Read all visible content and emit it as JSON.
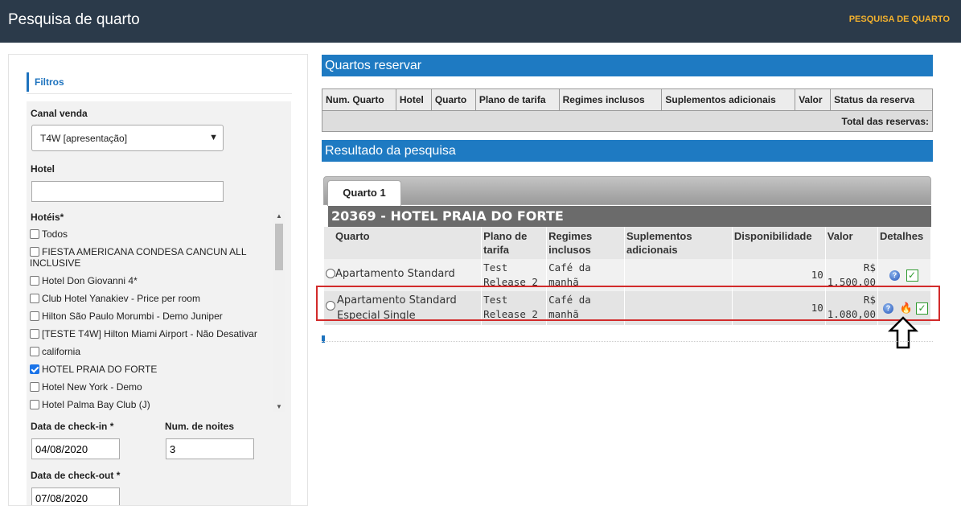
{
  "header": {
    "title": "Pesquisa de quarto",
    "breadcrumb": "PESQUISA DE QUARTO"
  },
  "filters": {
    "title": "Filtros",
    "canal_label": "Canal venda",
    "canal_value": "T4W [apresentação]",
    "hotel_label": "Hotel",
    "hotel_value": "",
    "hoteis_label": "Hotéis*",
    "hoteis": [
      {
        "label": "Todos",
        "checked": false
      },
      {
        "label": "FIESTA AMERICANA CONDESA CANCUN ALL INCLUSIVE",
        "checked": false
      },
      {
        "label": "Hotel Don Giovanni 4*",
        "checked": false
      },
      {
        "label": "Club Hotel Yanakiev - Price per room",
        "checked": false
      },
      {
        "label": "Hilton São Paulo Morumbi - Demo Juniper",
        "checked": false
      },
      {
        "label": "[TESTE T4W] Hilton Miami Airport - Não Desativar",
        "checked": false
      },
      {
        "label": "california",
        "checked": false
      },
      {
        "label": "HOTEL PRAIA DO FORTE",
        "checked": true
      },
      {
        "label": "Hotel New York - Demo",
        "checked": false
      },
      {
        "label": "Hotel Palma Bay Club (J)",
        "checked": false
      }
    ],
    "checkin_label": "Data de check-in *",
    "checkin_value": "04/08/2020",
    "noites_label": "Num. de noites",
    "noites_value": "3",
    "checkout_label": "Data de check-out *",
    "checkout_value": "07/08/2020"
  },
  "reservar": {
    "title": "Quartos reservar",
    "columns": [
      "Num. Quarto",
      "Hotel",
      "Quarto",
      "Plano de tarifa",
      "Regimes inclusos",
      "Suplementos adicionais",
      "Valor",
      "Status da reserva"
    ],
    "total_label": "Total das reservas:"
  },
  "resultado": {
    "title": "Resultado da pesquisa",
    "tab": "Quarto 1",
    "hotel_header": "20369 - HOTEL PRAIA DO FORTE",
    "columns": {
      "quarto": "Quarto",
      "plano": "Plano de tarifa",
      "regimes": "Regimes inclusos",
      "suplementos": "Suplementos adicionais",
      "disponibilidade": "Disponibilidade",
      "valor": "Valor",
      "detalhes": "Detalhes"
    },
    "rows": [
      {
        "quarto": "Apartamento Standard",
        "plano": "Test Release 2",
        "regime": "Café da manhã",
        "suplementos": "",
        "disponibilidade": "10",
        "valor": "R$ 1.500,00"
      },
      {
        "quarto": "Apartamento Standard Especial Single",
        "plano": "Test Release 2",
        "regime": "Café da manhã",
        "suplementos": "",
        "disponibilidade": "10",
        "valor": "R$ 1.080,00"
      }
    ]
  },
  "icons": {
    "info": "question-circle-icon",
    "hot": "fire-icon",
    "select": "checkbox-check-icon"
  },
  "colors": {
    "header_bg": "#2b3a4a",
    "accent": "#1e7ac2",
    "breadcrumb": "#f3b12d",
    "highlight": "#d22b2b"
  }
}
